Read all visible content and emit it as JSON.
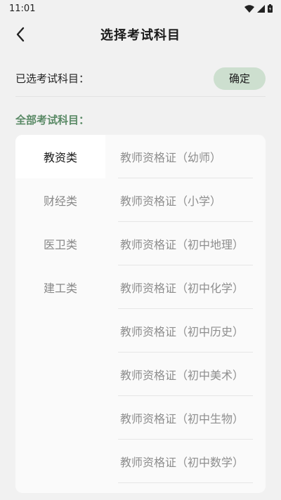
{
  "status_bar": {
    "time": "11:01"
  },
  "app_bar": {
    "title": "选择考试科目"
  },
  "selected": {
    "label": "已选考试科目：",
    "confirm_label": "确定"
  },
  "all_subjects_label": "全部考试科目：",
  "categories": [
    {
      "label": "教资类",
      "active": true
    },
    {
      "label": "财经类",
      "active": false
    },
    {
      "label": "医卫类",
      "active": false
    },
    {
      "label": "建工类",
      "active": false
    }
  ],
  "subjects": [
    "教师资格证（幼师）",
    "教师资格证（小学）",
    "教师资格证（初中地理）",
    "教师资格证（初中化学）",
    "教师资格证（初中历史）",
    "教师资格证（初中美术）",
    "教师资格证（初中生物）",
    "教师资格证（初中数学）"
  ],
  "colors": {
    "accent": "#5a8a66",
    "confirm_bg": "#cddfcf",
    "background": "#f1f1f1"
  }
}
